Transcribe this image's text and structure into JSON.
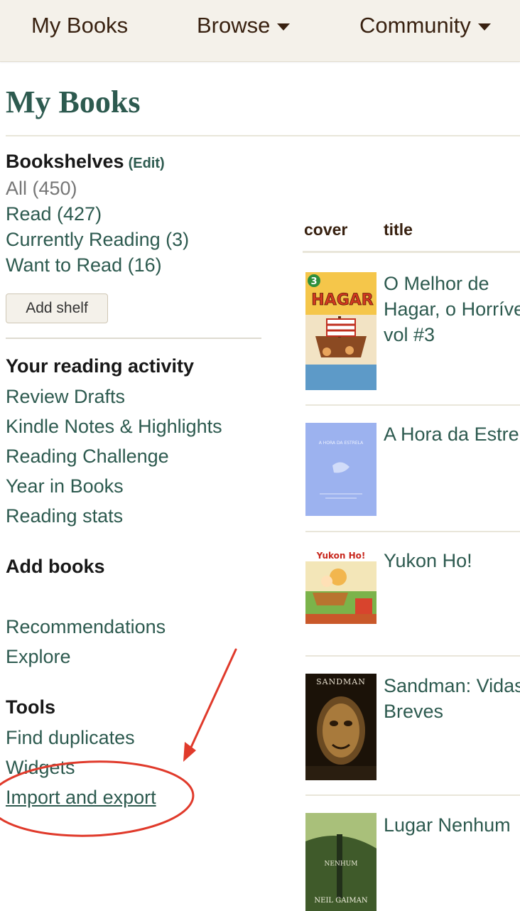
{
  "nav": {
    "my_books": "My Books",
    "browse": "Browse",
    "community": "Community"
  },
  "page_title": "My Books",
  "bookshelves": {
    "heading": "Bookshelves",
    "edit": "(Edit)",
    "shelves": [
      {
        "label": "All (450)"
      },
      {
        "label": "Read (427)"
      },
      {
        "label": "Currently Reading (3)"
      },
      {
        "label": "Want to Read (16)"
      }
    ],
    "add_shelf": "Add shelf"
  },
  "reading_activity": {
    "heading": "Your reading activity",
    "links": [
      "Review Drafts",
      "Kindle Notes & Highlights",
      "Reading Challenge",
      "Year in Books",
      "Reading stats"
    ]
  },
  "add_books": {
    "heading": "Add books",
    "links": [
      "Recommendations",
      "Explore"
    ]
  },
  "tools": {
    "heading": "Tools",
    "links": [
      "Find duplicates",
      "Widgets",
      "Import and export"
    ]
  },
  "table": {
    "columns": [
      "cover",
      "title"
    ],
    "books": [
      {
        "title_lines": [
          "O Melhor de",
          "Hagar, o Horrível",
          "vol #3"
        ],
        "cover_text": "HAGAR",
        "cover_badge": "3"
      },
      {
        "title_lines": [
          "A Hora da Estrela"
        ],
        "cover_text": "A HORA DA ESTRELA"
      },
      {
        "title_lines": [
          "Yukon Ho!"
        ],
        "cover_text": "Yukon Ho!"
      },
      {
        "title_lines": [
          "Sandman: Vidas",
          "Breves"
        ],
        "cover_text": "SANDMAN"
      },
      {
        "title_lines": [
          "Lugar Nenhum"
        ],
        "cover_text": "NEIL GAIMAN"
      }
    ]
  },
  "colors": {
    "accent": "#2d5a4f",
    "nav_bg": "#f4f1ea",
    "nav_text": "#382110",
    "annotation": "#e03a2b"
  }
}
